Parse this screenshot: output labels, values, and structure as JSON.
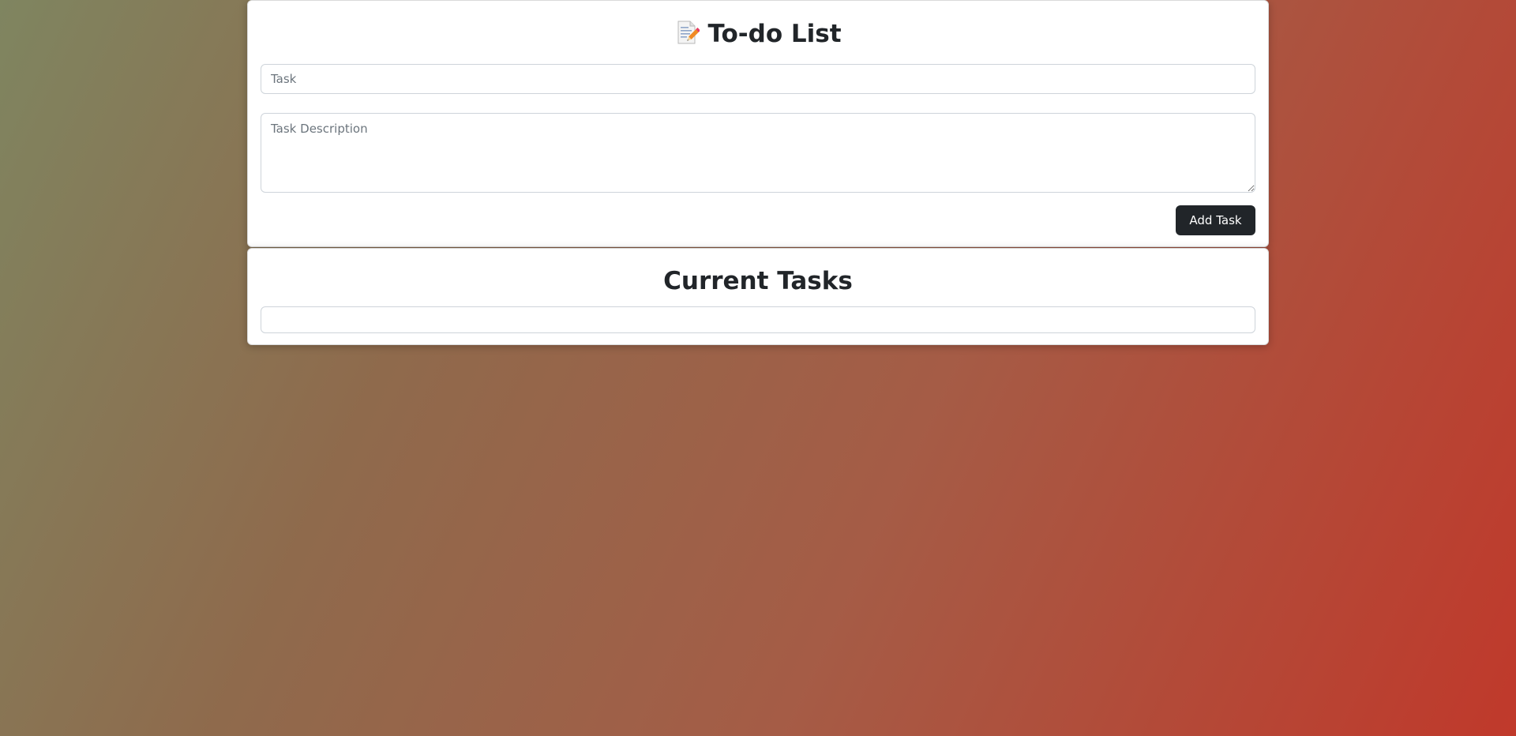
{
  "form": {
    "title": "To-do List",
    "title_icon": "memo-icon",
    "task_placeholder": "Task",
    "task_value": "",
    "description_placeholder": "Task Description",
    "description_value": "",
    "add_button_label": "Add Task",
    "button_color": "#212529"
  },
  "tasks": {
    "title": "Current Tasks",
    "items": []
  }
}
